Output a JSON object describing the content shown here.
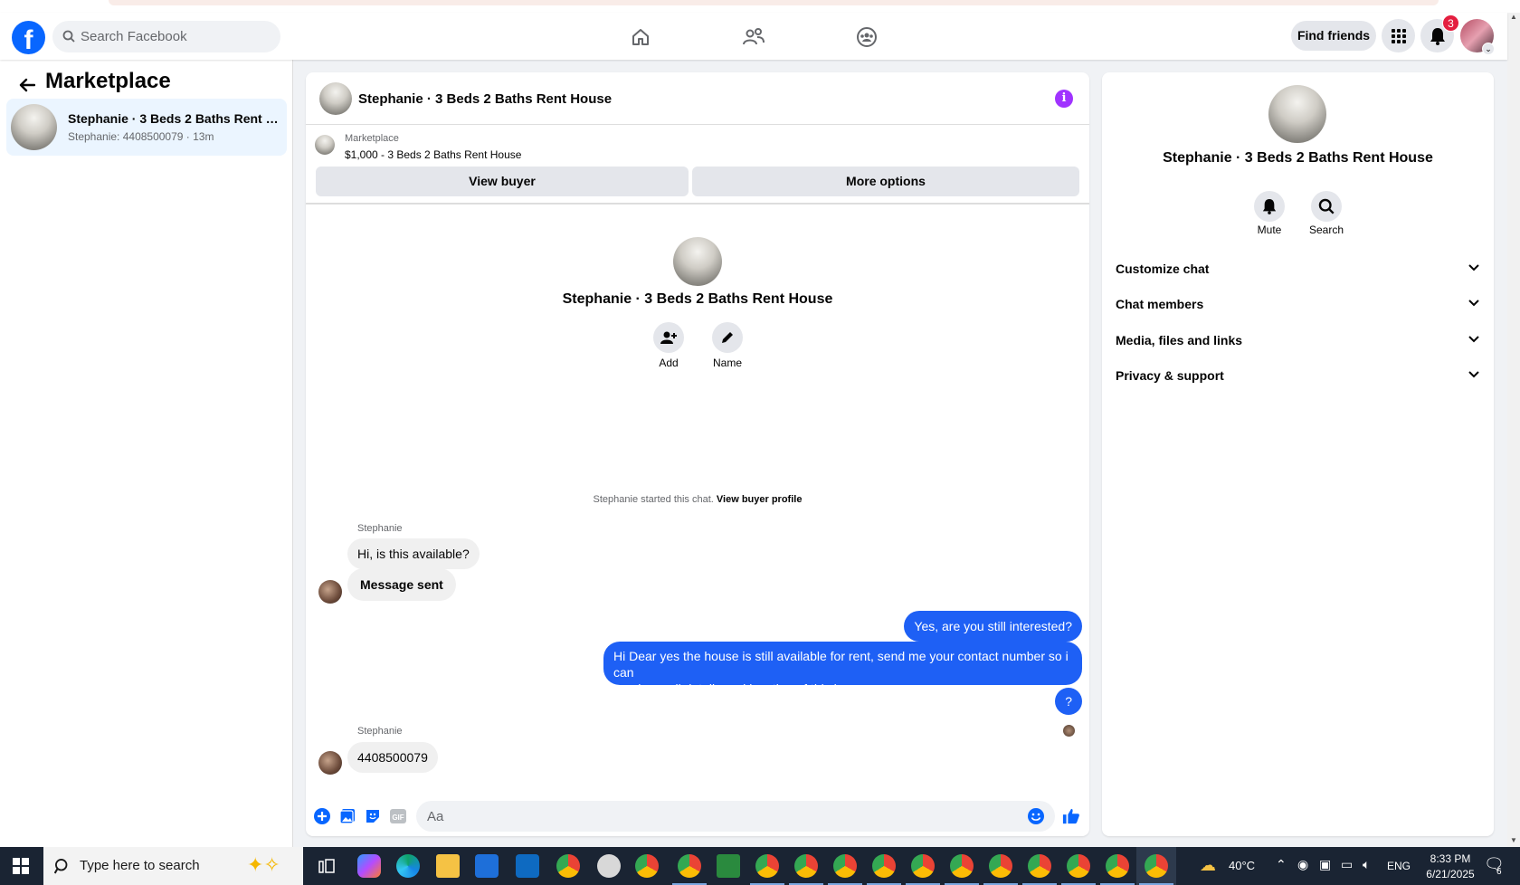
{
  "header": {
    "search_placeholder": "Search Facebook",
    "find_friends": "Find friends",
    "notification_count": "3"
  },
  "sidebar": {
    "title": "Marketplace",
    "conversation": {
      "title": "Stephanie · 3 Beds 2 Baths Rent House",
      "subtitle": "Stephanie: 4408500079 · 13m"
    }
  },
  "chat": {
    "title": "Stephanie · 3 Beds 2 Baths Rent House",
    "marketplace_label": "Marketplace",
    "listing": "$1,000 - 3 Beds 2 Baths Rent House",
    "view_buyer": "View buyer",
    "more_options": "More options",
    "profile_name": "Stephanie · 3 Beds 2 Baths Rent House",
    "add_label": "Add",
    "name_label": "Name",
    "started_text": "Stephanie started this chat.",
    "view_buyer_profile": "View buyer profile",
    "messages": [
      {
        "sender": "Stephanie",
        "text": "Hi, is this available?"
      },
      {
        "text": "Message sent"
      },
      {
        "text": "Yes, are you still interested?"
      },
      {
        "line1": "Hi Dear yes the house is still available for rent, send me your contact number so i can",
        "line2": "send you all details and location of this house"
      },
      {
        "text": "?"
      },
      {
        "sender": "Stephanie",
        "text": "4408500079"
      }
    ],
    "composer_placeholder": "Aa"
  },
  "details": {
    "name": "Stephanie · 3 Beds 2 Baths Rent House",
    "mute": "Mute",
    "search": "Search",
    "sections": [
      "Customize chat",
      "Chat members",
      "Media, files and links",
      "Privacy & support"
    ]
  },
  "taskbar": {
    "search_placeholder": "Type here to search",
    "temperature": "40°C",
    "language": "ENG",
    "time": "8:33 PM",
    "date": "6/21/2025",
    "notif_count": "6"
  },
  "colors": {
    "brand": "#0866ff",
    "my_bubble": "#1e60f5",
    "info": "#a033ff"
  }
}
